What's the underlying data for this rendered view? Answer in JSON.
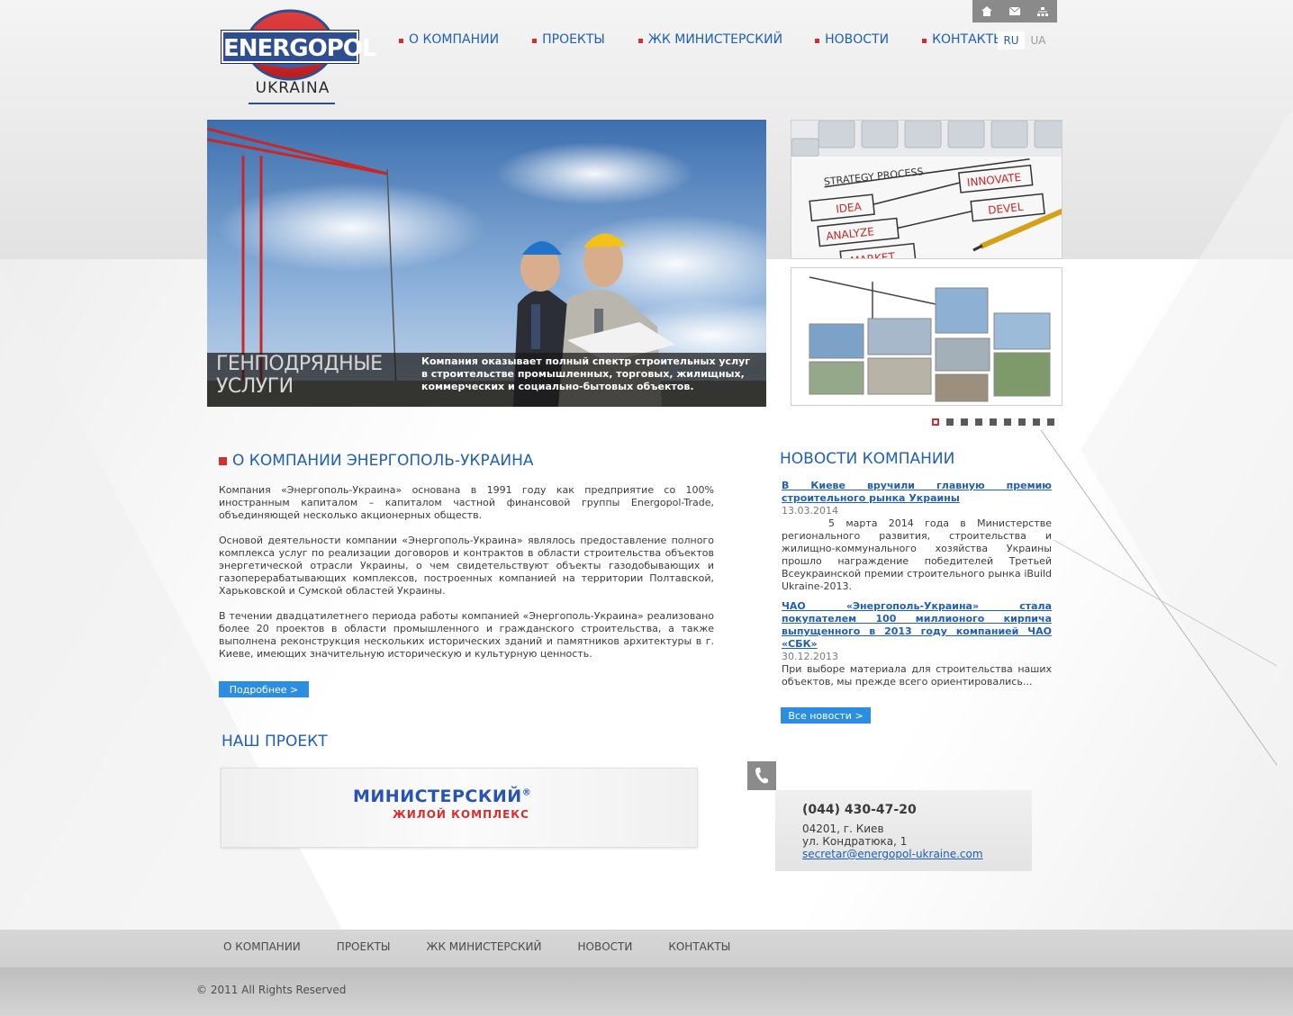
{
  "utility": {
    "icons": [
      "home-icon",
      "mail-icon",
      "sitemap-icon"
    ]
  },
  "logo": {
    "brand": "ENERGOPOL",
    "sub": "UKRAINA"
  },
  "nav": {
    "items": [
      {
        "label": "О КОМПАНИИ"
      },
      {
        "label": "ПРОЕКТЫ"
      },
      {
        "label": "ЖК МИНИСТЕРСКИЙ"
      },
      {
        "label": "НОВОСТИ"
      },
      {
        "label": "КОНТАКТЫ"
      }
    ]
  },
  "lang": {
    "ru": "RU",
    "ua": "UA"
  },
  "hero": {
    "title_line1": "ГЕНПОДРЯДНЫЕ",
    "title_line2": "УСЛУГИ",
    "desc": "Компания оказывает полный спектр строительных услуг в строительстве промышленных, торговых, жилищных, коммерческих и социально-бытовых объектов."
  },
  "slider": {
    "count": 9,
    "active": 0
  },
  "about": {
    "title": "О КОМПАНИИ ЭНЕРГОПОЛЬ-УКРАИНА",
    "p1": "Компания «Энергополь-Украина» основана в 1991 году как предприятие со 100% иностранным капиталом – капиталом частной финансовой группы Energopol-Trade, объединяющей несколько акционерных обществ.",
    "p2": "Основой деятельности компании «Энергополь-Украина» являлось предоставление полного комплекса услуг по реализации договоров и контрактов в области строительства объектов энергетической отрасли Украины, о чем свидетельствуют объекты газодобывающих и газоперерабатывающих комплексов, построенных компанией на территории Полтавской, Харьковской и Сумской областей Украины.",
    "p3": "В течении двадцатилетнего периода работы компанией «Энергополь-Украина» реализовано более 20 проектов в области промышленного и гражданского строительства, а также выполнена реконструкция нескольких исторических зданий и памятников архитектуры в г. Киеве, имеющих значительную историческую и культурную ценность.",
    "more_btn": "Подробнее >"
  },
  "project": {
    "title": "НАШ ПРОЕКТ",
    "name": "МИНИСТЕРСКИЙ",
    "reg": "®",
    "sub": "ЖИЛОЙ КОМПЛЕКС"
  },
  "news": {
    "title": "НОВОСТИ КОМПАНИИ",
    "items": [
      {
        "link": "В Киеве вручили главную премию строительного рынка Украины",
        "date": "13.03.2014",
        "body": "5 марта 2014 года в Министерстве регионального развития, строительства и жилищно-коммунального хозяйства Украины прошло награждение победителей Третьей Всеукраинской премии строительного рынка iBuild Ukraine-2013."
      },
      {
        "link": "ЧАО «Энергополь-Украина» стала покупателем 100 миллионого кирпича выпущенного в 2013 году компанией ЧАО «СБК»",
        "date": "30.12.2013",
        "body": "При выборе материала для строительства наших объектов, мы прежде всего ориентировались..."
      }
    ],
    "all_btn": "Все новости >"
  },
  "contact": {
    "phone": "(044) 430-47-20",
    "address1": "04201, г. Киев",
    "address2": "ул. Кондратюка, 1",
    "email": "secretar@energopol-ukraine.com"
  },
  "footer": {
    "items": [
      {
        "label": "О КОМПАНИИ"
      },
      {
        "label": "ПРОЕКТЫ"
      },
      {
        "label": "ЖК МИНИСТЕРСКИЙ"
      },
      {
        "label": "НОВОСТИ"
      },
      {
        "label": "КОНТАКТЫ"
      }
    ],
    "copyright": "© 2011 All Rights Reserved"
  },
  "colors": {
    "accent": "#1f5fb5",
    "bullet": "#d23030",
    "button": "#2b8ee0"
  }
}
